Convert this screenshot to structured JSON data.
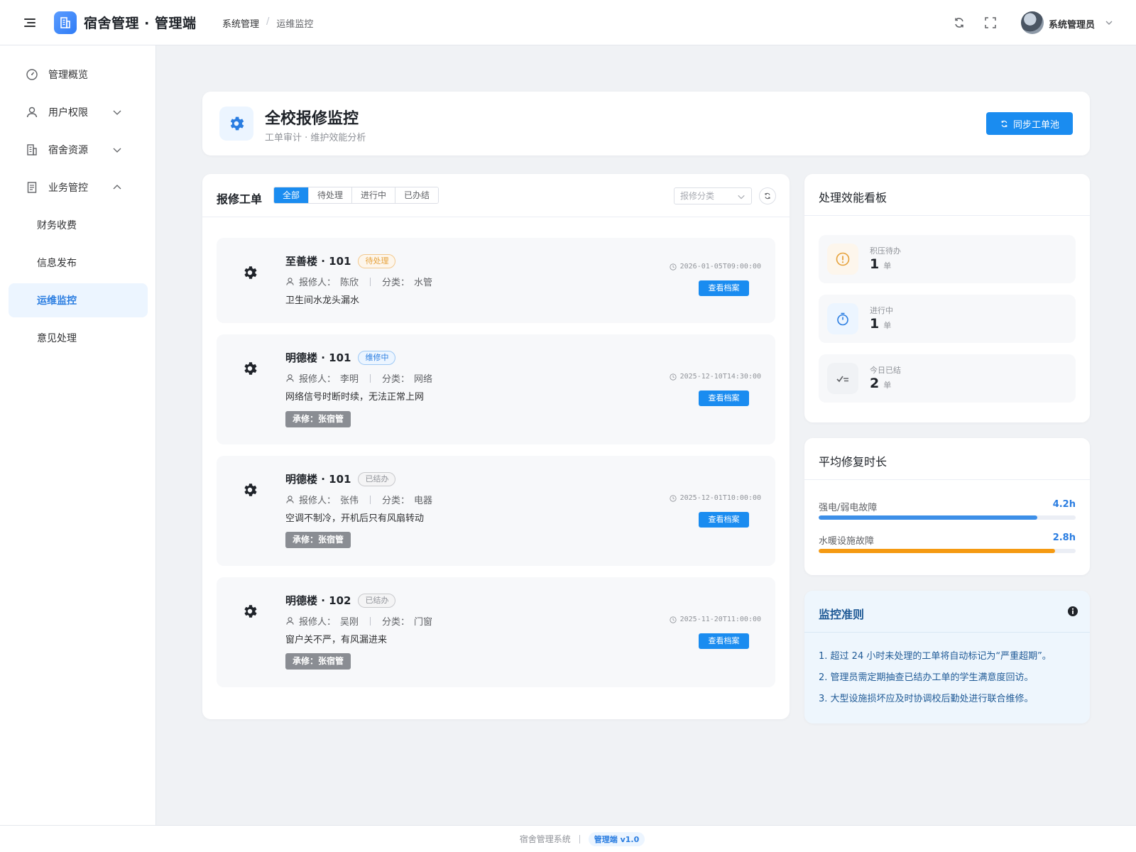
{
  "header": {
    "app_title": "宿舍管理 · 管理端",
    "breadcrumb": [
      "系统管理",
      "运维监控"
    ],
    "username": "系统管理员"
  },
  "sidebar": {
    "items": [
      {
        "label": "管理概览",
        "icon": "dashboard-icon"
      },
      {
        "label": "用户权限",
        "icon": "user-icon",
        "expanded": false
      },
      {
        "label": "宿舍资源",
        "icon": "building-icon",
        "expanded": false
      },
      {
        "label": "业务管控",
        "icon": "document-icon",
        "expanded": true
      },
      {
        "label": "财务收费"
      },
      {
        "label": "信息发布"
      },
      {
        "label": "运维监控",
        "active": true
      },
      {
        "label": "意见处理"
      }
    ]
  },
  "page": {
    "title": "全校报修监控",
    "subtitle": "工单审计 · 维护效能分析",
    "sync_label": "同步工单池"
  },
  "orders": {
    "title": "报修工单",
    "tabs": [
      "全部",
      "待处理",
      "进行中",
      "已办结"
    ],
    "active_tab": "全部",
    "filter_placeholder": "报修分类",
    "reporter_label": "报修人：",
    "category_label": "分类：",
    "view_label": "查看档案",
    "items": [
      {
        "room": "至善楼 · 101",
        "status": "待处理",
        "reporter": "陈欣",
        "category": "水管",
        "desc": "卫生间水龙头漏水",
        "time": "2026-01-05T09:00:00",
        "worker": ""
      },
      {
        "room": "明德楼 · 101",
        "status": "维修中",
        "reporter": "李明",
        "category": "网络",
        "desc": "网络信号时断时续，无法正常上网",
        "time": "2025-12-10T14:30:00",
        "worker": "承修：张宿管"
      },
      {
        "room": "明德楼 · 101",
        "status": "已结办",
        "reporter": "张伟",
        "category": "电器",
        "desc": "空调不制冷，开机后只有风扇转动",
        "time": "2025-12-01T10:00:00",
        "worker": "承修：张宿管"
      },
      {
        "room": "明德楼 · 102",
        "status": "已结办",
        "reporter": "吴刚",
        "category": "门窗",
        "desc": "窗户关不严，有风漏进来",
        "time": "2025-11-20T11:00:00",
        "worker": "承修：张宿管"
      }
    ]
  },
  "perf": {
    "title": "处理效能看板",
    "unit": "单",
    "stats": [
      {
        "label": "积压待办",
        "value": "1",
        "color": "#e6a23c",
        "icon": "warning-icon"
      },
      {
        "label": "进行中",
        "value": "1",
        "color": "#2a7de1",
        "icon": "stopwatch-icon"
      },
      {
        "label": "今日已结",
        "value": "2",
        "color": "#606266",
        "icon": "check-list-icon"
      }
    ]
  },
  "avg": {
    "title": "平均修复时长",
    "rows": [
      {
        "label": "强电/弱电故障",
        "value": "4.2h",
        "fraction": 0.85,
        "color": "#3d8fe8"
      },
      {
        "label": "水暖设施故障",
        "value": "2.8h",
        "fraction": 0.92,
        "color": "#f59a12"
      }
    ]
  },
  "rules": {
    "title": "监控准则",
    "items": [
      "1. 超过 24 小时未处理的工单将自动标记为“严重超期”。",
      "2. 管理员需定期抽查已结办工单的学生满意度回访。",
      "3. 大型设施损坏应及时协调校后勤处进行联合维修。"
    ]
  },
  "footer": {
    "system": "宿舍管理系统",
    "version": "管理端 v1.0"
  }
}
